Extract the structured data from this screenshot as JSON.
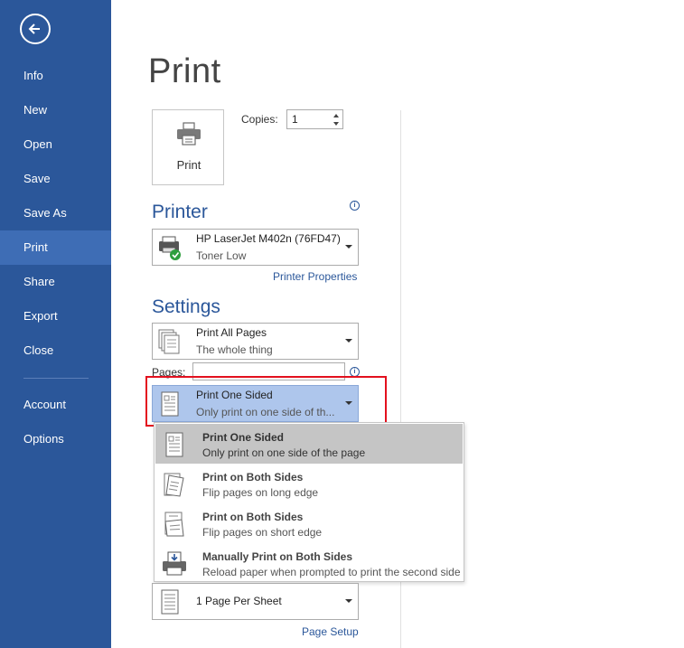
{
  "nav": {
    "items": [
      {
        "label": "Info"
      },
      {
        "label": "New"
      },
      {
        "label": "Open"
      },
      {
        "label": "Save"
      },
      {
        "label": "Save As"
      },
      {
        "label": "Print"
      },
      {
        "label": "Share"
      },
      {
        "label": "Export"
      },
      {
        "label": "Close"
      },
      {
        "label": "Account"
      },
      {
        "label": "Options"
      }
    ],
    "active": "Print",
    "back_icon": "back-arrow-icon"
  },
  "page": {
    "title": "Print"
  },
  "print": {
    "button_label": "Print",
    "copies_label": "Copies:",
    "copies_value": "1"
  },
  "printer": {
    "heading": "Printer",
    "name": "HP LaserJet M402n (76FD47)",
    "status": "Toner Low",
    "properties_link": "Printer Properties"
  },
  "settings": {
    "heading": "Settings",
    "pages_range": {
      "title": "Print All Pages",
      "subtitle": "The whole thing"
    },
    "pages_label": "Pages:",
    "pages_value": "",
    "sided": {
      "title": "Print One Sided",
      "subtitle": "Only print on one side of th..."
    },
    "per_sheet": {
      "title": "1 Page Per Sheet"
    },
    "page_setup_link": "Page Setup"
  },
  "sided_menu": [
    {
      "title": "Print One Sided",
      "subtitle": "Only print on one side of the page",
      "icon": "one-sided-page-icon"
    },
    {
      "title": "Print on Both Sides",
      "subtitle": "Flip pages on long edge",
      "icon": "flip-long-edge-icon"
    },
    {
      "title": "Print on Both Sides",
      "subtitle": "Flip pages on short edge",
      "icon": "flip-short-edge-icon"
    },
    {
      "title": "Manually Print on Both Sides",
      "subtitle": "Reload paper when prompted to print the second side",
      "icon": "manual-duplex-icon"
    }
  ],
  "colors": {
    "sidebar": "#2b579a",
    "accent": "#2b579a",
    "selected": "#aec6ec",
    "highlight": "#e3101e"
  }
}
